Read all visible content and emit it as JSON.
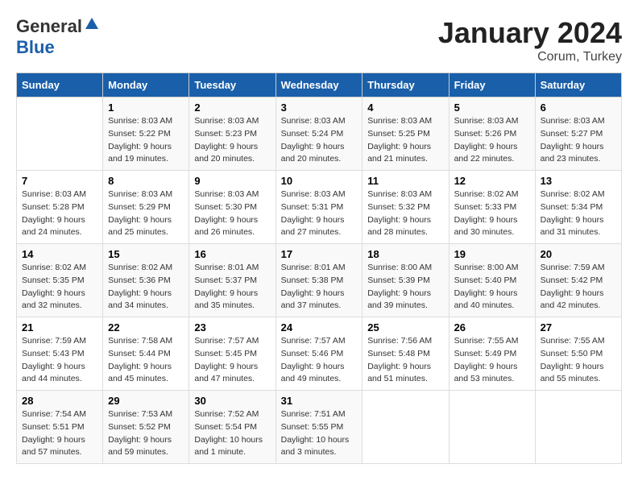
{
  "header": {
    "logo_general": "General",
    "logo_blue": "Blue",
    "title": "January 2024",
    "subtitle": "Corum, Turkey"
  },
  "days_of_week": [
    "Sunday",
    "Monday",
    "Tuesday",
    "Wednesday",
    "Thursday",
    "Friday",
    "Saturday"
  ],
  "weeks": [
    [
      {
        "day": "",
        "sunrise": "",
        "sunset": "",
        "daylight": ""
      },
      {
        "day": "1",
        "sunrise": "Sunrise: 8:03 AM",
        "sunset": "Sunset: 5:22 PM",
        "daylight": "Daylight: 9 hours and 19 minutes."
      },
      {
        "day": "2",
        "sunrise": "Sunrise: 8:03 AM",
        "sunset": "Sunset: 5:23 PM",
        "daylight": "Daylight: 9 hours and 20 minutes."
      },
      {
        "day": "3",
        "sunrise": "Sunrise: 8:03 AM",
        "sunset": "Sunset: 5:24 PM",
        "daylight": "Daylight: 9 hours and 20 minutes."
      },
      {
        "day": "4",
        "sunrise": "Sunrise: 8:03 AM",
        "sunset": "Sunset: 5:25 PM",
        "daylight": "Daylight: 9 hours and 21 minutes."
      },
      {
        "day": "5",
        "sunrise": "Sunrise: 8:03 AM",
        "sunset": "Sunset: 5:26 PM",
        "daylight": "Daylight: 9 hours and 22 minutes."
      },
      {
        "day": "6",
        "sunrise": "Sunrise: 8:03 AM",
        "sunset": "Sunset: 5:27 PM",
        "daylight": "Daylight: 9 hours and 23 minutes."
      }
    ],
    [
      {
        "day": "7",
        "sunrise": "Sunrise: 8:03 AM",
        "sunset": "Sunset: 5:28 PM",
        "daylight": "Daylight: 9 hours and 24 minutes."
      },
      {
        "day": "8",
        "sunrise": "Sunrise: 8:03 AM",
        "sunset": "Sunset: 5:29 PM",
        "daylight": "Daylight: 9 hours and 25 minutes."
      },
      {
        "day": "9",
        "sunrise": "Sunrise: 8:03 AM",
        "sunset": "Sunset: 5:30 PM",
        "daylight": "Daylight: 9 hours and 26 minutes."
      },
      {
        "day": "10",
        "sunrise": "Sunrise: 8:03 AM",
        "sunset": "Sunset: 5:31 PM",
        "daylight": "Daylight: 9 hours and 27 minutes."
      },
      {
        "day": "11",
        "sunrise": "Sunrise: 8:03 AM",
        "sunset": "Sunset: 5:32 PM",
        "daylight": "Daylight: 9 hours and 28 minutes."
      },
      {
        "day": "12",
        "sunrise": "Sunrise: 8:02 AM",
        "sunset": "Sunset: 5:33 PM",
        "daylight": "Daylight: 9 hours and 30 minutes."
      },
      {
        "day": "13",
        "sunrise": "Sunrise: 8:02 AM",
        "sunset": "Sunset: 5:34 PM",
        "daylight": "Daylight: 9 hours and 31 minutes."
      }
    ],
    [
      {
        "day": "14",
        "sunrise": "Sunrise: 8:02 AM",
        "sunset": "Sunset: 5:35 PM",
        "daylight": "Daylight: 9 hours and 32 minutes."
      },
      {
        "day": "15",
        "sunrise": "Sunrise: 8:02 AM",
        "sunset": "Sunset: 5:36 PM",
        "daylight": "Daylight: 9 hours and 34 minutes."
      },
      {
        "day": "16",
        "sunrise": "Sunrise: 8:01 AM",
        "sunset": "Sunset: 5:37 PM",
        "daylight": "Daylight: 9 hours and 35 minutes."
      },
      {
        "day": "17",
        "sunrise": "Sunrise: 8:01 AM",
        "sunset": "Sunset: 5:38 PM",
        "daylight": "Daylight: 9 hours and 37 minutes."
      },
      {
        "day": "18",
        "sunrise": "Sunrise: 8:00 AM",
        "sunset": "Sunset: 5:39 PM",
        "daylight": "Daylight: 9 hours and 39 minutes."
      },
      {
        "day": "19",
        "sunrise": "Sunrise: 8:00 AM",
        "sunset": "Sunset: 5:40 PM",
        "daylight": "Daylight: 9 hours and 40 minutes."
      },
      {
        "day": "20",
        "sunrise": "Sunrise: 7:59 AM",
        "sunset": "Sunset: 5:42 PM",
        "daylight": "Daylight: 9 hours and 42 minutes."
      }
    ],
    [
      {
        "day": "21",
        "sunrise": "Sunrise: 7:59 AM",
        "sunset": "Sunset: 5:43 PM",
        "daylight": "Daylight: 9 hours and 44 minutes."
      },
      {
        "day": "22",
        "sunrise": "Sunrise: 7:58 AM",
        "sunset": "Sunset: 5:44 PM",
        "daylight": "Daylight: 9 hours and 45 minutes."
      },
      {
        "day": "23",
        "sunrise": "Sunrise: 7:57 AM",
        "sunset": "Sunset: 5:45 PM",
        "daylight": "Daylight: 9 hours and 47 minutes."
      },
      {
        "day": "24",
        "sunrise": "Sunrise: 7:57 AM",
        "sunset": "Sunset: 5:46 PM",
        "daylight": "Daylight: 9 hours and 49 minutes."
      },
      {
        "day": "25",
        "sunrise": "Sunrise: 7:56 AM",
        "sunset": "Sunset: 5:48 PM",
        "daylight": "Daylight: 9 hours and 51 minutes."
      },
      {
        "day": "26",
        "sunrise": "Sunrise: 7:55 AM",
        "sunset": "Sunset: 5:49 PM",
        "daylight": "Daylight: 9 hours and 53 minutes."
      },
      {
        "day": "27",
        "sunrise": "Sunrise: 7:55 AM",
        "sunset": "Sunset: 5:50 PM",
        "daylight": "Daylight: 9 hours and 55 minutes."
      }
    ],
    [
      {
        "day": "28",
        "sunrise": "Sunrise: 7:54 AM",
        "sunset": "Sunset: 5:51 PM",
        "daylight": "Daylight: 9 hours and 57 minutes."
      },
      {
        "day": "29",
        "sunrise": "Sunrise: 7:53 AM",
        "sunset": "Sunset: 5:52 PM",
        "daylight": "Daylight: 9 hours and 59 minutes."
      },
      {
        "day": "30",
        "sunrise": "Sunrise: 7:52 AM",
        "sunset": "Sunset: 5:54 PM",
        "daylight": "Daylight: 10 hours and 1 minute."
      },
      {
        "day": "31",
        "sunrise": "Sunrise: 7:51 AM",
        "sunset": "Sunset: 5:55 PM",
        "daylight": "Daylight: 10 hours and 3 minutes."
      },
      {
        "day": "",
        "sunrise": "",
        "sunset": "",
        "daylight": ""
      },
      {
        "day": "",
        "sunrise": "",
        "sunset": "",
        "daylight": ""
      },
      {
        "day": "",
        "sunrise": "",
        "sunset": "",
        "daylight": ""
      }
    ]
  ]
}
